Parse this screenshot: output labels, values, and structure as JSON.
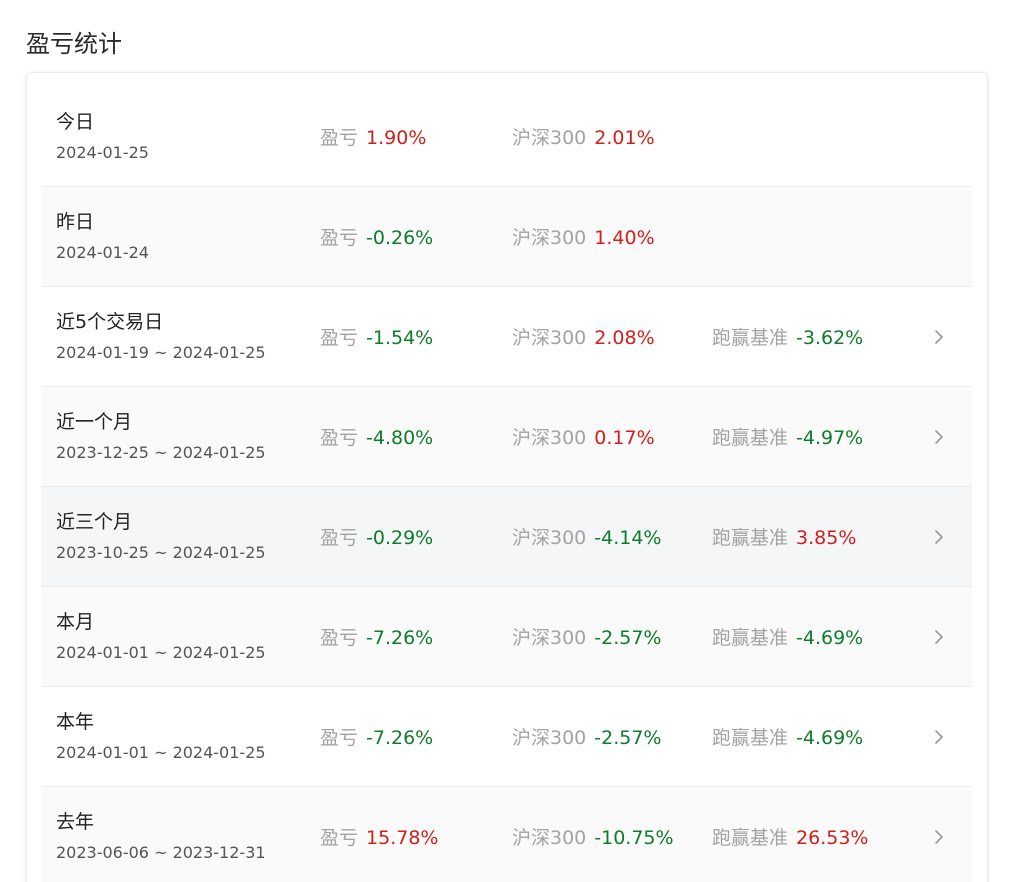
{
  "title": "盈亏统计",
  "labels": {
    "pnl": "盈亏",
    "benchmark": "沪深300",
    "excess": "跑赢基准"
  },
  "colors": {
    "positive": "#d0201c",
    "negative": "#0d7d2a"
  },
  "rows": [
    {
      "period": "今日",
      "range": "2024-01-25",
      "pnl": "1.90%",
      "benchmark": "2.01%",
      "excess": null
    },
    {
      "period": "昨日",
      "range": "2024-01-24",
      "pnl": "-0.26%",
      "benchmark": "1.40%",
      "excess": null
    },
    {
      "period": "近5个交易日",
      "range": "2024-01-19 ~ 2024-01-25",
      "pnl": "-1.54%",
      "benchmark": "2.08%",
      "excess": "-3.62%"
    },
    {
      "period": "近一个月",
      "range": "2023-12-25 ~ 2024-01-25",
      "pnl": "-4.80%",
      "benchmark": "0.17%",
      "excess": "-4.97%"
    },
    {
      "period": "近三个月",
      "range": "2023-10-25 ~ 2024-01-25",
      "pnl": "-0.29%",
      "benchmark": "-4.14%",
      "excess": "3.85%"
    },
    {
      "period": "本月",
      "range": "2024-01-01 ~ 2024-01-25",
      "pnl": "-7.26%",
      "benchmark": "-2.57%",
      "excess": "-4.69%"
    },
    {
      "period": "本年",
      "range": "2024-01-01 ~ 2024-01-25",
      "pnl": "-7.26%",
      "benchmark": "-2.57%",
      "excess": "-4.69%"
    },
    {
      "period": "去年",
      "range": "2023-06-06 ~ 2023-12-31",
      "pnl": "15.78%",
      "benchmark": "-10.75%",
      "excess": "26.53%"
    }
  ]
}
